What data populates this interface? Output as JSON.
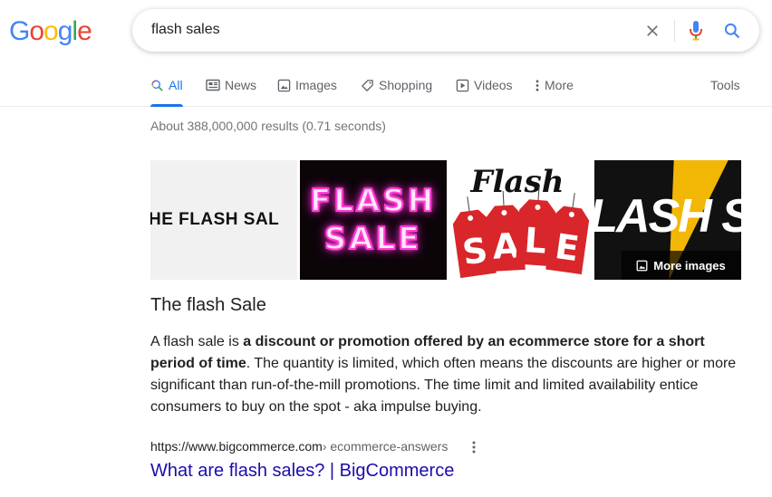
{
  "logo": {
    "letters": [
      "G",
      "o",
      "o",
      "g",
      "l",
      "e"
    ],
    "colors": [
      "#4285f4",
      "#ea4335",
      "#fbbc05",
      "#4285f4",
      "#34a853",
      "#ea4335"
    ]
  },
  "search": {
    "query": "flash sales",
    "clear_icon": "close-icon",
    "mic_icon": "mic-icon",
    "search_icon": "search-icon"
  },
  "tabs": [
    {
      "label": "All",
      "icon": "search-icon",
      "active": true
    },
    {
      "label": "News",
      "icon": "newspaper-icon"
    },
    {
      "label": "Images",
      "icon": "image-icon"
    },
    {
      "label": "Shopping",
      "icon": "tag-icon"
    },
    {
      "label": "Videos",
      "icon": "play-icon"
    },
    {
      "label": "More",
      "icon": "more-vert-icon"
    }
  ],
  "tools_label": "Tools",
  "stats": "About 388,000,000 results (0.71 seconds)",
  "images": {
    "t1_text": "HE FLASH SAL",
    "t2_line1": "FLASH",
    "t2_line2": "SALE",
    "t3_script": "Flash",
    "t3_tags": [
      "S",
      "A",
      "L",
      "E"
    ],
    "t4_text": "LASH SAL",
    "more_images": "More images"
  },
  "snippet": {
    "title": "The flash Sale",
    "prefix": "A flash sale is ",
    "bold": "a discount or promotion offered by an ecommerce store for a short period of time",
    "suffix": ". The quantity is limited, which often means the discounts are higher or more significant than run-of-the-mill promotions. The time limit and limited availability entice consumers to buy on the spot - aka impulse buying."
  },
  "result": {
    "url": "https://www.bigcommerce.com",
    "crumb": " › ecommerce-answers",
    "title": "What are flash sales? | BigCommerce"
  },
  "colors": {
    "accent": "#1a73e8",
    "link": "#1a0dab",
    "muted": "#70757a"
  }
}
